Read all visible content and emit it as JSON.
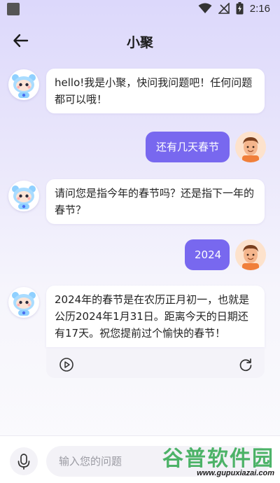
{
  "status_bar": {
    "time": "2:16"
  },
  "header": {
    "title": "小聚"
  },
  "messages": [
    {
      "sender": "bot",
      "text": "hello!我是小聚，快问我问题吧！任何问题都可以哦！"
    },
    {
      "sender": "user",
      "text": "还有几天春节"
    },
    {
      "sender": "bot",
      "text": "请问您是指今年的春节吗？还是指下一年的春节？"
    },
    {
      "sender": "user",
      "text": "2024"
    },
    {
      "sender": "bot",
      "text": "2024年的春节是在农历正月初一，也就是公历2024年1月31日。距离今天的日期还有17天。祝您提前过个愉快的春节！"
    }
  ],
  "input": {
    "placeholder": "输入您的问题",
    "value": ""
  },
  "watermark": {
    "brand": "谷普软件园",
    "url": "www.gupuxiazai.com"
  },
  "colors": {
    "accent": "#7868ef",
    "background_top": "#dcd8fb",
    "bubble": "#ffffff"
  },
  "icons": [
    "back-arrow-icon",
    "wifi-icon",
    "no-signal-icon",
    "battery-icon",
    "play-icon",
    "refresh-icon",
    "microphone-icon"
  ]
}
